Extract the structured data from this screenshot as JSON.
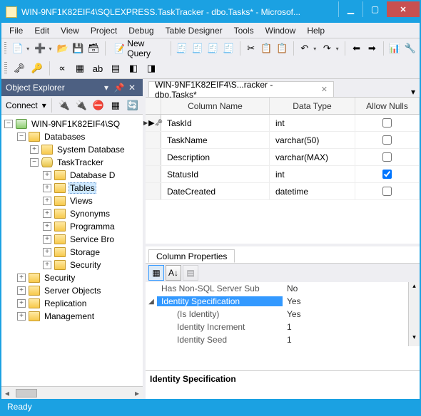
{
  "window": {
    "title": "WIN-9NF1K82EIF4\\SQLEXPRESS.TaskTracker - dbo.Tasks* - Microsof..."
  },
  "menu": [
    "File",
    "Edit",
    "View",
    "Project",
    "Debug",
    "Table Designer",
    "Tools",
    "Window",
    "Help"
  ],
  "toolbar": {
    "new_query": "New Query"
  },
  "objexp": {
    "title": "Object Explorer",
    "connect": "Connect",
    "server": "WIN-9NF1K82EIF4\\SQ",
    "nodes": {
      "databases": "Databases",
      "sysdb": "System Database",
      "tasktracker": "TaskTracker",
      "dbdiag": "Database D",
      "tables": "Tables",
      "views": "Views",
      "synonyms": "Synonyms",
      "programma": "Programma",
      "servicebro": "Service Bro",
      "storage": "Storage",
      "security_inner": "Security",
      "security": "Security",
      "serverobjects": "Server Objects",
      "replication": "Replication",
      "management": "Management"
    }
  },
  "doc": {
    "tab": "WIN-9NF1K82EIF4\\S...racker - dbo.Tasks*"
  },
  "grid": {
    "headers": {
      "col": "Column Name",
      "type": "Data Type",
      "nulls": "Allow Nulls"
    },
    "rows": [
      {
        "name": "TaskId",
        "type": "int",
        "nulls": false,
        "key": true
      },
      {
        "name": "TaskName",
        "type": "varchar(50)",
        "nulls": false,
        "key": false
      },
      {
        "name": "Description",
        "type": "varchar(MAX)",
        "nulls": false,
        "key": false
      },
      {
        "name": "StatusId",
        "type": "int",
        "nulls": true,
        "key": false
      },
      {
        "name": "DateCreated",
        "type": "datetime",
        "nulls": false,
        "key": false
      }
    ]
  },
  "props": {
    "tab": "Column Properties",
    "rows": [
      {
        "exp": "",
        "k": "Has Non-SQL Server Sub",
        "v": "No",
        "indent": false,
        "sel": false
      },
      {
        "exp": "◢",
        "k": "Identity Specification",
        "v": "Yes",
        "indent": false,
        "sel": true
      },
      {
        "exp": "",
        "k": "(Is Identity)",
        "v": "Yes",
        "indent": true,
        "sel": false
      },
      {
        "exp": "",
        "k": "Identity Increment",
        "v": "1",
        "indent": true,
        "sel": false
      },
      {
        "exp": "",
        "k": "Identity Seed",
        "v": "1",
        "indent": true,
        "sel": false
      }
    ],
    "desc": "Identity Specification"
  },
  "status": "Ready"
}
